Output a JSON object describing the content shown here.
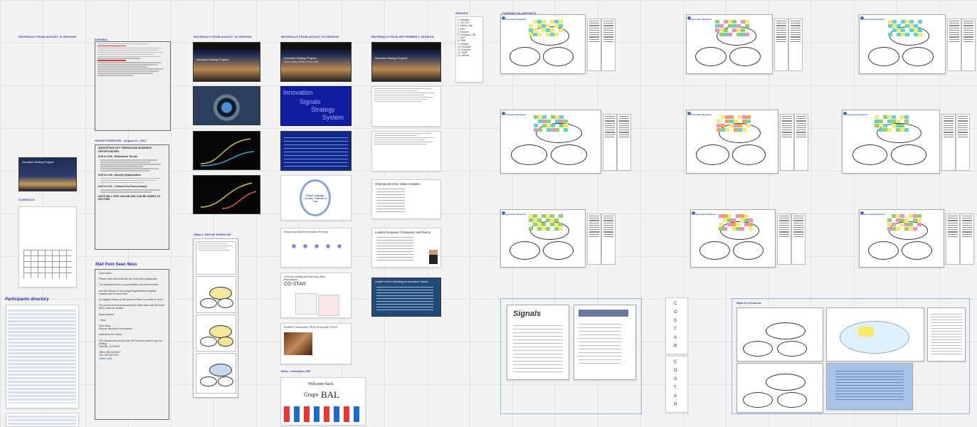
{
  "headers": {
    "aug11": "MATERIALS FROM AUGUST 11 SESSION",
    "agenda": "AGENDA",
    "aug18": "MATERIALS FROM AUGUST 18 SESSION",
    "aug25": "MATERIALS FROM AUGUST 25 SESSION",
    "sep1": "MATERIALS FROM SEPTEMBER 1 SESSION",
    "groups": "GROUPS",
    "blueprints": "COMPANY BLUEPRINTS"
  },
  "group_exercise": {
    "label": "GROUP EXERCISE - August 11, 2021",
    "title": "IDENTIFYING KEY TRENDS AND BUSINESS OPPORTUNITIES",
    "s1": "5:20 to 5:50 - Brainstorm Trends",
    "s2": "5:50 to 6:00 - Identify Opportunities",
    "s3": "6:00 to 6:10 - Choose Key Focus Area(s)",
    "footer": "ANYS WILL STAY ONLINE AND CAN BE ADDED TO ANYTIME"
  },
  "mail": {
    "heading": "Mail from Sean Ness",
    "greeting": "Lisa/Yuriyen,",
    "p1": "Please share this email with the Grupo BAL participants.",
    "p2": "The download link for my presentation can be found here.",
    "p3": "And the Science & Technology/Organizational Capacity research can be found here.",
    "p4": "I'm happy to follow up with anyone if there is a desire to do so.",
    "p5": "I've put out an internal ask about 3D within times and will revert when I have an answer.",
    "regards": "Warm regards,",
    "sig1": "- Sean",
    "sig2": "Sean Ness",
    "sig3": "Director, Business Development",
    "sig4": "Institute for the Future",
    "sig5": "201 Hamilton Avenue (but use 307 Emerson Street if you are visiting)",
    "sig6": "Palo Alto, CA 94301",
    "office": "Office: 650.233.9517",
    "cell": "Cell: 408.406.7022",
    "twitter": "Twitter: @iftf"
  },
  "participants_directory": "Participants directory",
  "schedule_label": "SCHEDULE",
  "small_group": "SMALL GROUP EXERCISE",
  "slides": {
    "program_title": "Innovation Strategy Program",
    "program_sub": "Silicon Valley Center & Grupo BAL",
    "iss_1": "Innovation",
    "iss_2": "Signals",
    "iss_3": "Strategy",
    "iss_4": "System",
    "shared_lang": "Shared Language, Concepts, Processes & Tools",
    "simple_shared": "Simple and Shared Innovation Process",
    "tool_creating": "A tool for creating and improving Value Propositions",
    "costar": "CO-STAR",
    "shared_practices": "SHARED LANGUAGE, PRACTICES AND TOOLS",
    "champions": "Champions Drive Value Creation",
    "leaders": "Leaders Empower Champions and Teams",
    "leaders_role": "Leader's Role in Building an Innovation System",
    "slides_pdf": "Slides - Intervention PDF",
    "welcome": "Welcome back",
    "grupo": "Grupo",
    "bal": "BAL"
  },
  "groups": [
    "1. Bolsanta",
    "2. Citi_ST1",
    "3. Electro_Bal",
    "4. BPH",
    "5. Fravotto",
    "6. Fundación_AB",
    "7. GNP",
    "8. ITAM",
    "9. Peñoles",
    "10. Remobal",
    "11. Profuturo",
    "12. TANE",
    "13. Valmex"
  ],
  "blueprint_label": "Innovation Blueprint",
  "signals": "Signals",
  "mapa": "Mapa de la Empresa",
  "costar_letters": [
    "C",
    "O",
    "S",
    "T",
    "A",
    "R"
  ],
  "colors": {
    "header_blue": "#3a3ab8",
    "slide_navy": "#0f1d6e",
    "sticky_yellow": "#f7ea6a",
    "sticky_cyan": "#5fd3d0",
    "sticky_green": "#8fd06a",
    "sticky_pink": "#f08fbf",
    "sticky_orange": "#f5a24b",
    "frame_blue": "#8fb8e8"
  }
}
